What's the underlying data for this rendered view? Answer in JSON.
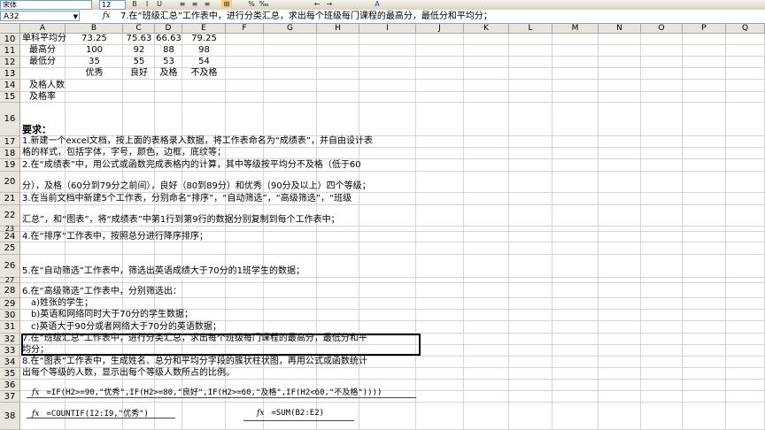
{
  "toolbar": {
    "font_name": "宋体",
    "font_size": "12",
    "buttons": [
      "B",
      "I",
      "U",
      "≡",
      "≡",
      "≡",
      "⊞",
      "%",
      "‰",
      "←",
      "→",
      "A"
    ]
  },
  "formula_bar": {
    "name_box": "A32",
    "fx": "fx",
    "content": "7.在“班级汇总”工作表中，进行分类汇总，求出每个班级每门课程的最高分，最低分和平均分；"
  },
  "columns": [
    "A",
    "B",
    "C",
    "D",
    "E",
    "F",
    "G",
    "H",
    "I",
    "J",
    "K",
    "L",
    "M",
    "N",
    "O",
    "P",
    "Q"
  ],
  "rows": [
    "10",
    "11",
    "12",
    "13",
    "14",
    "15",
    "16",
    "17",
    "18",
    "19",
    "20",
    "21",
    "22",
    "23",
    "24",
    "25",
    "26",
    "27",
    "28",
    "29",
    "30",
    "31",
    "32",
    "33",
    "34",
    "35",
    "36",
    "37",
    "38"
  ],
  "cells": {
    "a10": "单科平均分",
    "b10": "73.25",
    "c10": "75.63",
    "d10": "66.63",
    "e10": "79.25",
    "a11": "最高分",
    "b11": "100",
    "c11": "92",
    "d11": "88",
    "e11": "98",
    "a12": "最低分",
    "b12": "35",
    "c12": "55",
    "d12": "53",
    "e12": "54",
    "b13": "优秀",
    "c13": "良好",
    "d13": "及格",
    "e13": "不及格",
    "a14": "及格人数",
    "a15": "及格率",
    "a16": "要求：",
    "a17": "1.新建一个excel文档，按上面的表格录入数据，将工作表命名为“成绩表”，并自由设计表",
    "a18": "格的样式，包括字体，字号，颜色，边框，底纹等；",
    "a19": "2.在“成绩表”中，用公式或函数完成表格内的计算，其中等级按平均分不及格（低于60",
    "a20": "分），及格（60分到79分之前间），良好（80到89分）和优秀（90分及以上）四个等级；",
    "a21": "3.在当前文档中新建5个工作表，分别命名“排序”，“自动筛选”，“高级筛选”，“班级",
    "a22": "汇总”，和“图表”，将“成绩表”中第1行到第9行的数据分别复制到每个工作表中；",
    "a24": "4.在“排序”工作表中，按照总分进行降序排序；",
    "a26": "5.在“自动筛选”工作表中，筛选出英语成绩大于70分的1班学生的数据；",
    "a28": "6.在“高级筛选”工作表中，分别筛选出：",
    "a29": "a)姓张的学生；",
    "a30": "b)英语和网络同时大于70分的学生数据；",
    "a31": "c)英语大于90分或者网络大于70分的英语数据；",
    "a32": "7.在“班级汇总”工作表中，进行分类汇总，求出每个班级每门课程的最高分，最低分和平",
    "a33": "均分；",
    "a34": "8.在“图表”工作表中，生成姓名、总分和平均分字段的簇状柱状图，再用公式或函数统计",
    "a35": "出每个等级的人数，显示出每个等级人数所占的比例。"
  },
  "formulas": {
    "if_formula": "=IF(H2>=90,\"优秀\",IF(H2>=80,\"良好\",IF(H2>=60,\"及格\",IF(H2<60,\"不及格\"))))",
    "countif_formula": "=COUNTIF(I2:I9,\"优秀\")",
    "sum_formula": "=SUM(B2:E2)",
    "fx_label": "fx"
  }
}
